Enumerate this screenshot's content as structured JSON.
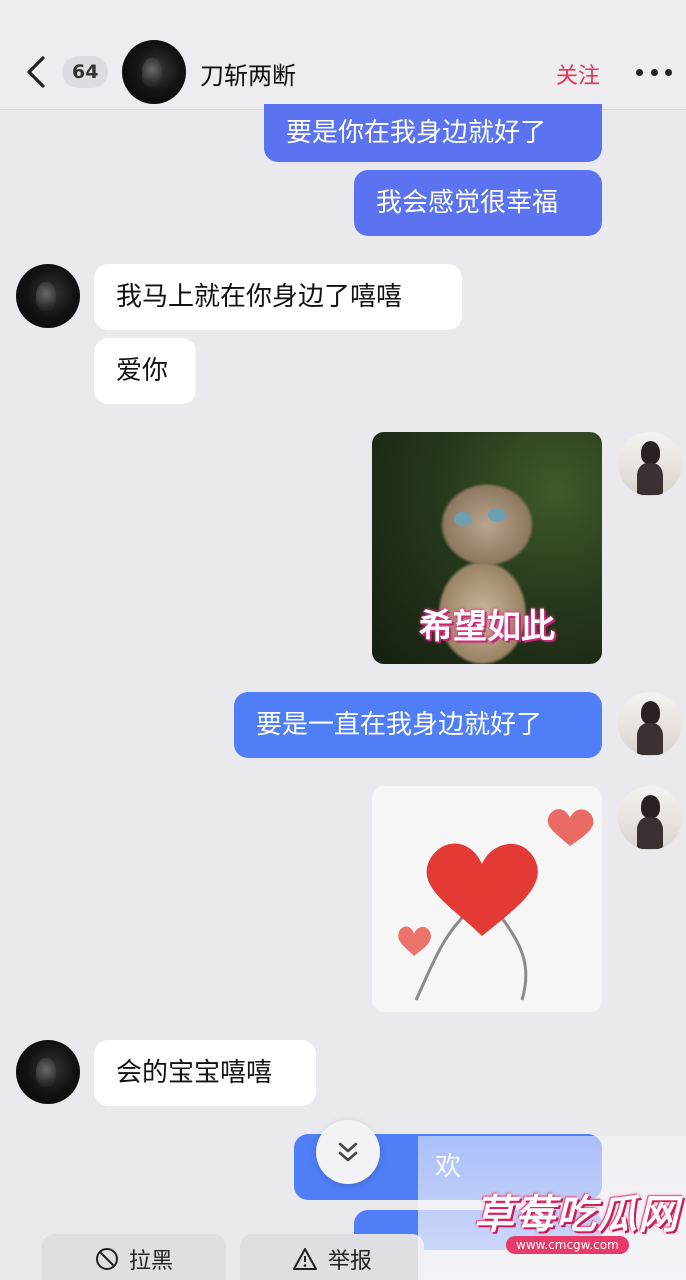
{
  "header": {
    "unread_count": "64",
    "contact_name": "刀斩两断",
    "follow_label": "关注"
  },
  "messages": [
    {
      "from": "me",
      "type": "text",
      "text": "要是你在我身边就好了"
    },
    {
      "from": "me",
      "type": "text",
      "text": "我会感觉很幸福"
    },
    {
      "from": "them",
      "type": "text",
      "text": "我马上就在你身边了嘻嘻"
    },
    {
      "from": "them",
      "type": "text",
      "text": "爱你"
    },
    {
      "from": "me",
      "type": "sticker",
      "caption": "希望如此"
    },
    {
      "from": "me",
      "type": "text",
      "text": "要是一直在我身边就好了"
    },
    {
      "from": "me",
      "type": "sticker"
    },
    {
      "from": "them",
      "type": "text",
      "text": "会的宝宝嘻嘻"
    },
    {
      "from": "me",
      "type": "text",
      "text": "欢"
    }
  ],
  "bottom_bar": {
    "block_label": "拉黑",
    "report_label": "举报"
  },
  "watermark": {
    "title": "草莓吃瓜网",
    "url": "www.cmcgw.com"
  },
  "colors": {
    "outgoing_bubble": "#4f7ef7",
    "incoming_bubble": "#ffffff",
    "follow": "#e8344e",
    "background": "#e9e9ee"
  },
  "icons": [
    "back-chevron-icon",
    "more-dots-icon",
    "scroll-down-icon",
    "block-icon",
    "warning-icon"
  ]
}
